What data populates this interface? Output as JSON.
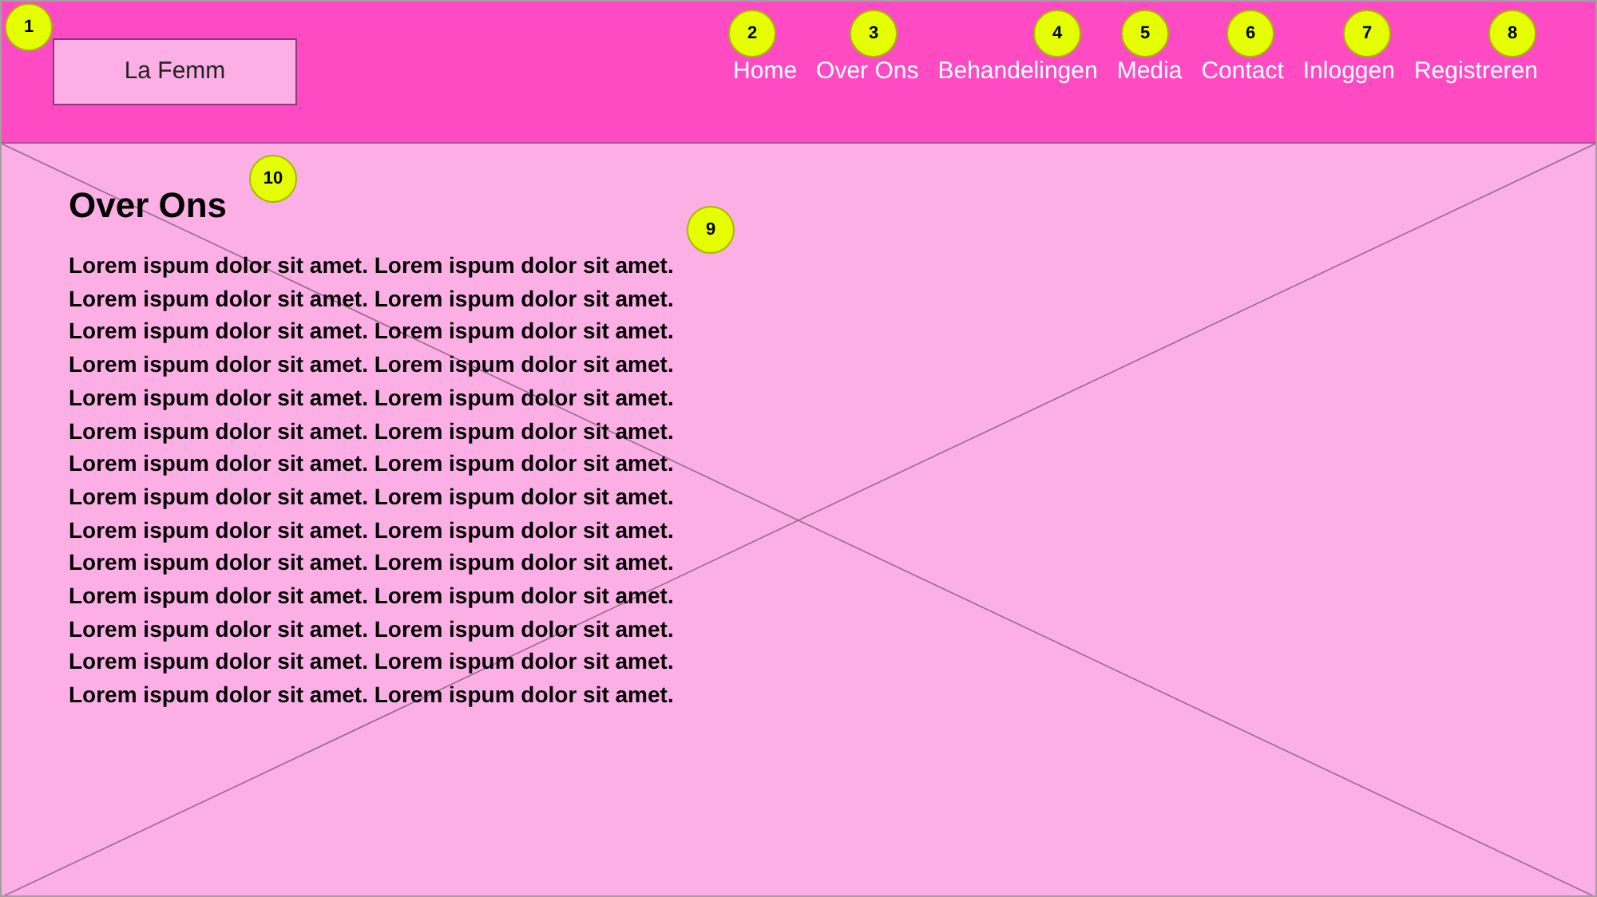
{
  "header": {
    "logo": "La Femm",
    "nav": [
      "Home",
      "Over Ons",
      "Behandelingen",
      "Media",
      "Contact",
      "Inloggen",
      "Registreren"
    ]
  },
  "content": {
    "title": "Over Ons",
    "lines": [
      "Lorem ispum dolor sit amet. Lorem ispum dolor sit amet.",
      "Lorem ispum dolor sit amet. Lorem ispum dolor sit amet.",
      "Lorem ispum dolor sit amet. Lorem ispum dolor sit amet.",
      "Lorem ispum dolor sit amet. Lorem ispum dolor sit amet.",
      "Lorem ispum dolor sit amet. Lorem ispum dolor sit amet.",
      "Lorem ispum dolor sit amet. Lorem ispum dolor sit amet.",
      "Lorem ispum dolor sit amet. Lorem ispum dolor sit amet.",
      "Lorem ispum dolor sit amet. Lorem ispum dolor sit amet.",
      "Lorem ispum dolor sit amet. Lorem ispum dolor sit amet.",
      "Lorem ispum dolor sit amet. Lorem ispum dolor sit amet.",
      "Lorem ispum dolor sit amet. Lorem ispum dolor sit amet.",
      "Lorem ispum dolor sit amet. Lorem ispum dolor sit amet.",
      "Lorem ispum dolor sit amet. Lorem ispum dolor sit amet.",
      "Lorem ispum dolor sit amet. Lorem ispum dolor sit amet."
    ]
  },
  "annotations": [
    "1",
    "2",
    "3",
    "4",
    "5",
    "6",
    "7",
    "8",
    "9",
    "10"
  ]
}
